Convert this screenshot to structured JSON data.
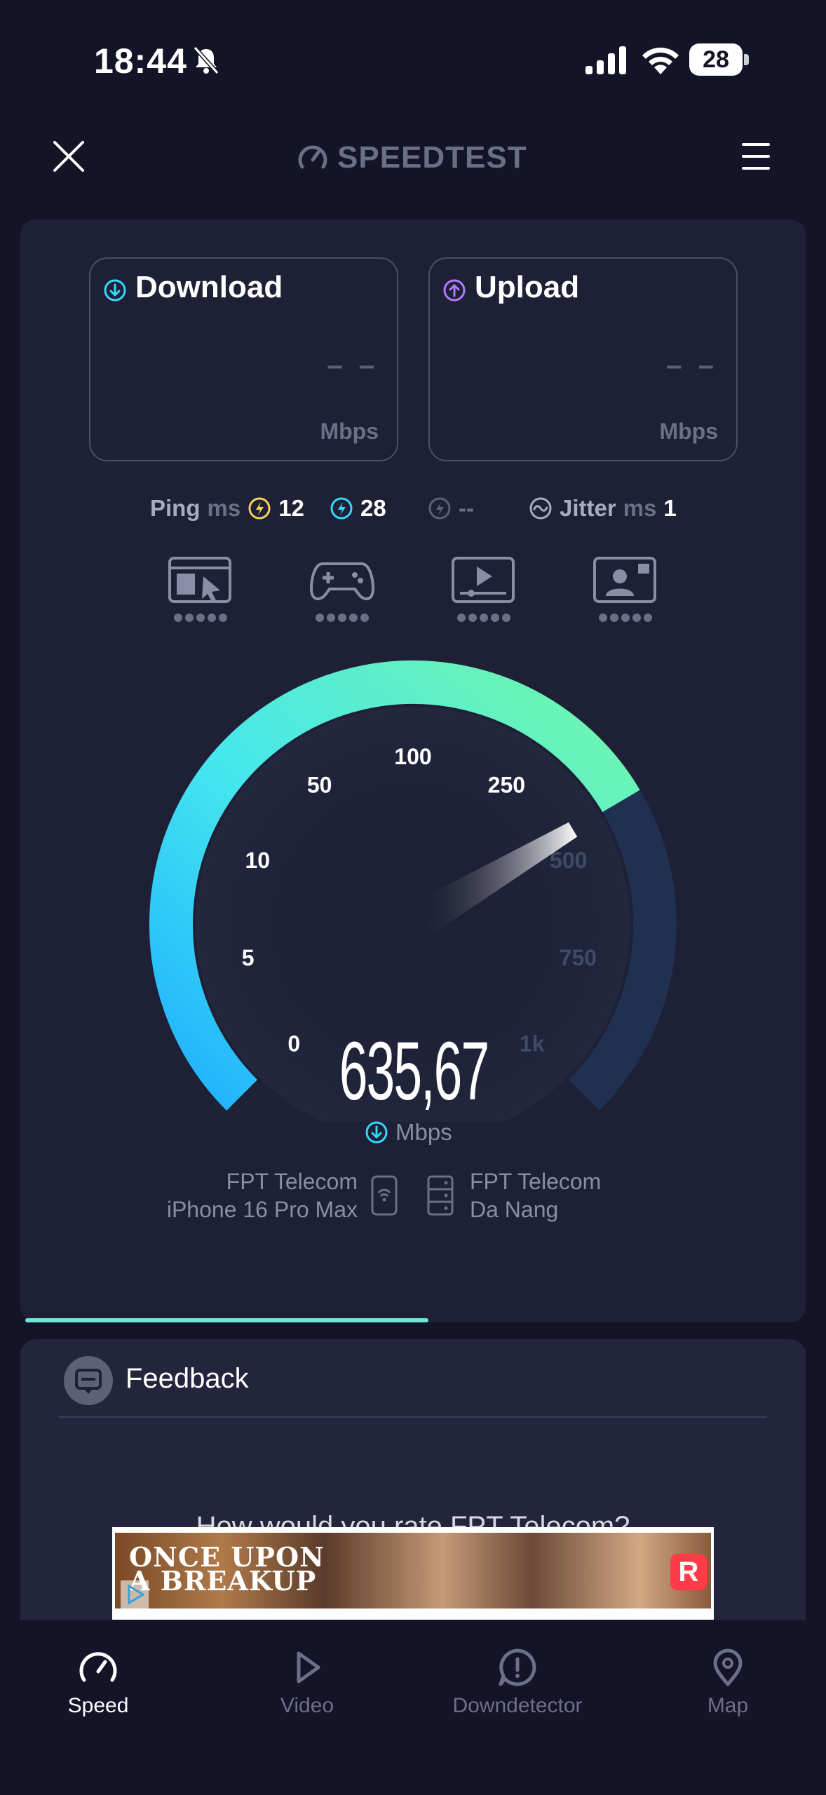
{
  "status_bar": {
    "time": "18:44",
    "battery": "28"
  },
  "header": {
    "logo_text": "SPEEDTEST"
  },
  "download": {
    "label": "Download",
    "value": "– –",
    "unit": "Mbps"
  },
  "upload": {
    "label": "Upload",
    "value": "– –",
    "unit": "Mbps"
  },
  "ping": {
    "label": "Ping",
    "unit": "ms",
    "idle": "12",
    "download": "28",
    "upload": "--",
    "jitter_label": "Jitter",
    "jitter_unit": "ms",
    "jitter": "1"
  },
  "service_icons": [
    "browsing-icon",
    "gaming-icon",
    "video-streaming-icon",
    "video-call-icon"
  ],
  "gauge": {
    "ticks": [
      "0",
      "5",
      "10",
      "50",
      "100",
      "250",
      "500",
      "750",
      "1k"
    ],
    "current_value": "635,67",
    "unit": "Mbps",
    "needle_fraction": 0.72
  },
  "test_progress": 0.52,
  "connection": {
    "provider": "FPT Telecom",
    "device": "iPhone 16 Pro Max",
    "server_provider": "FPT Telecom",
    "server_location": "Da Nang"
  },
  "feedback": {
    "label": "Feedback",
    "question": "How would you rate FPT Telecom?"
  },
  "ad": {
    "title_line1": "ONCE UPON",
    "title_line2": "A BREAKUP",
    "badge": "R"
  },
  "nav": [
    {
      "label": "Speed",
      "icon": "speedometer-icon",
      "active": true
    },
    {
      "label": "Video",
      "icon": "play-icon",
      "active": false
    },
    {
      "label": "Downdetector",
      "icon": "alert-icon",
      "active": false
    },
    {
      "label": "Map",
      "icon": "map-pin-icon",
      "active": false
    }
  ],
  "colors": {
    "background": "#131427",
    "card": "#1e2035",
    "accent_cyan": "#36d6ff",
    "accent_green": "#6ff5b0",
    "upload_purple": "#b07cff",
    "ping_yellow": "#f2d25a",
    "progress": "#6ee6d6"
  }
}
